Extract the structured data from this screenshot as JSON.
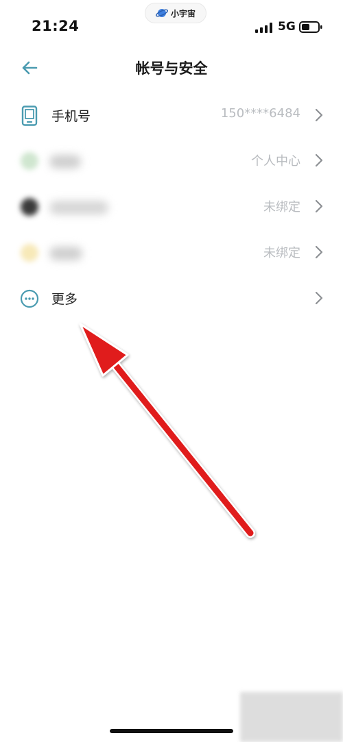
{
  "status_bar": {
    "time": "21:24",
    "pill_label": "小宇宙",
    "network": "5G"
  },
  "header": {
    "title": "帐号与安全"
  },
  "rows": [
    {
      "label": "手机号",
      "value": "150****6484"
    },
    {
      "label": "",
      "value": "个人中心"
    },
    {
      "label": "",
      "value": "未绑定"
    },
    {
      "label": "",
      "value": "未绑定"
    },
    {
      "label": "更多",
      "value": ""
    }
  ],
  "colors": {
    "accent": "#4a9bb0",
    "arrow": "#e01b1b",
    "value_text": "#b9bcc0"
  },
  "icons": {
    "back": "arrow-left-icon",
    "phone": "phone-icon",
    "more": "more-dots-icon",
    "chevron": "chevron-right-icon"
  }
}
